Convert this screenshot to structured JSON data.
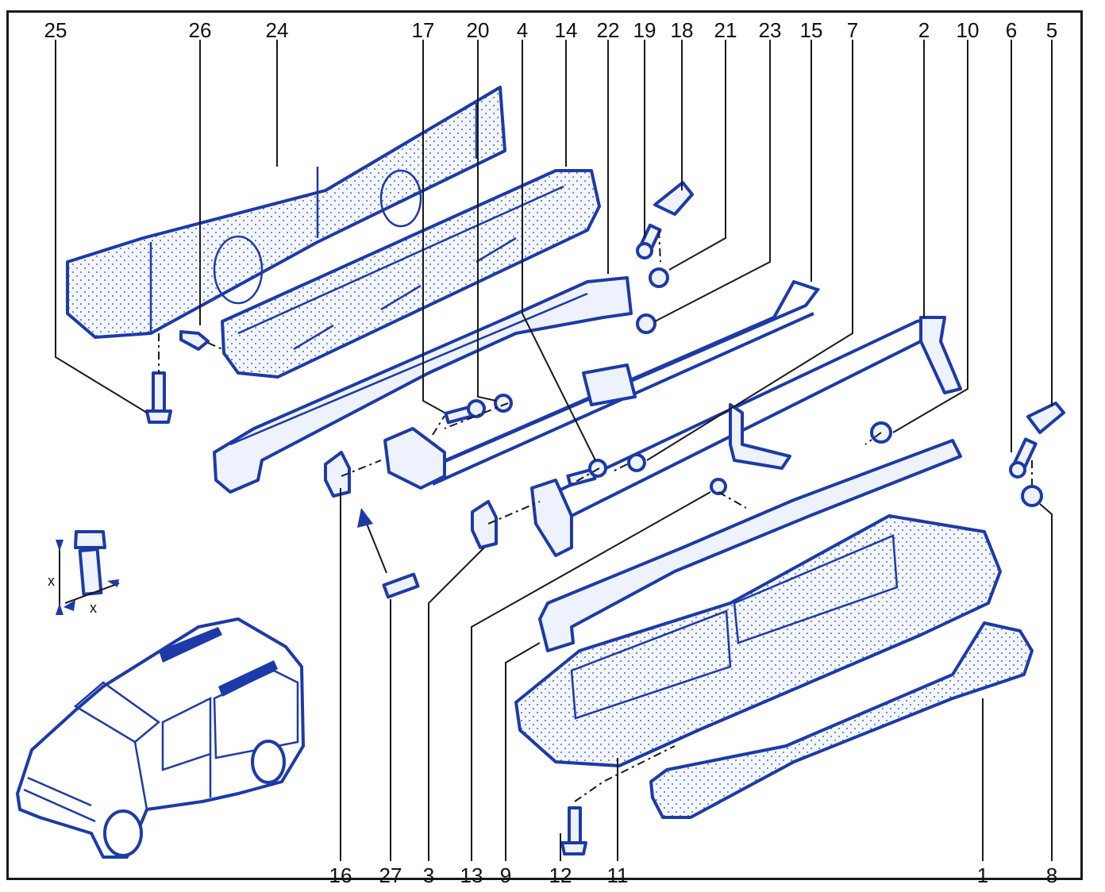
{
  "callouts_top": [
    {
      "label": "25"
    },
    {
      "label": "26"
    },
    {
      "label": "24"
    },
    {
      "label": "17"
    },
    {
      "label": "20"
    },
    {
      "label": "4"
    },
    {
      "label": "14"
    },
    {
      "label": "22"
    },
    {
      "label": "19"
    },
    {
      "label": "18"
    },
    {
      "label": "21"
    },
    {
      "label": "23"
    },
    {
      "label": "15"
    },
    {
      "label": "7"
    },
    {
      "label": "2"
    },
    {
      "label": "10"
    },
    {
      "label": "6"
    },
    {
      "label": "5"
    }
  ],
  "callouts_bottom": [
    {
      "label": "16"
    },
    {
      "label": "27"
    },
    {
      "label": "3"
    },
    {
      "label": "13"
    },
    {
      "label": "9"
    },
    {
      "label": "12"
    },
    {
      "label": "11"
    },
    {
      "label": "1"
    },
    {
      "label": "8"
    }
  ],
  "dimension_labels": {
    "x_vertical": "x",
    "x_horizontal": "x"
  },
  "colors": {
    "line_art": "#1c3aa9",
    "text": "#111111",
    "frame": "#1a1a1a"
  }
}
